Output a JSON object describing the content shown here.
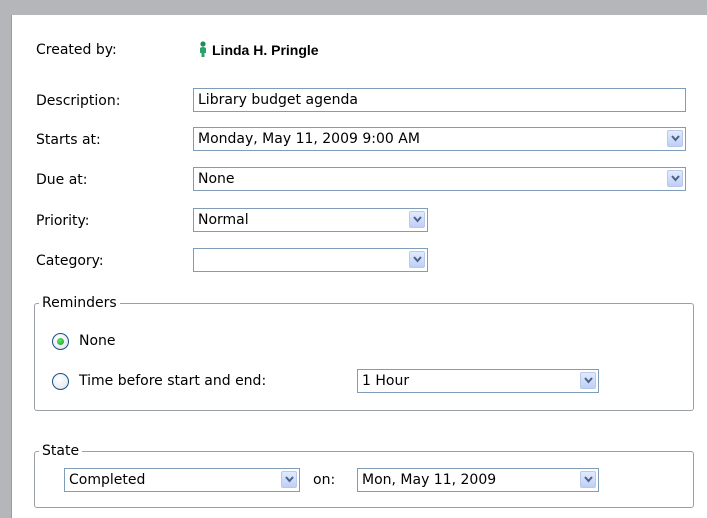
{
  "form": {
    "created_by": {
      "label": "Created by:",
      "value": "Linda H. Pringle",
      "icon": "person-icon"
    },
    "description": {
      "label": "Description:",
      "value": "Library budget agenda"
    },
    "starts_at": {
      "label": "Starts at:",
      "value": "Monday, May 11, 2009 9:00 AM"
    },
    "due_at": {
      "label": "Due at:",
      "value": "None"
    },
    "priority": {
      "label": "Priority:",
      "value": "Normal"
    },
    "category": {
      "label": "Category:",
      "value": ""
    }
  },
  "reminders": {
    "legend": "Reminders",
    "options": [
      {
        "label": "None",
        "selected": true
      },
      {
        "label": "Time before start and end:",
        "selected": false
      }
    ],
    "time_value": "1 Hour"
  },
  "state": {
    "legend": "State",
    "value": "Completed",
    "on_label": "on:",
    "date": "Mon, May 11, 2009"
  },
  "colors": {
    "frame": "#b4b6b9",
    "field_border": "#7f9db9",
    "radio_selected": "#1c9a22"
  }
}
